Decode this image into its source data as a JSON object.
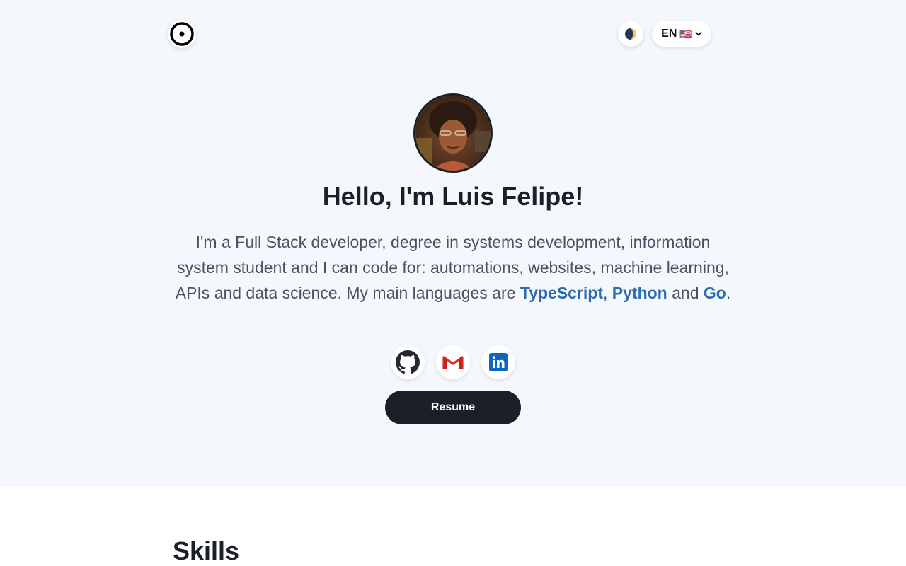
{
  "header": {
    "logo_icon": "circle-dot-icon",
    "theme_icon": "moon-icon",
    "language": {
      "code": "EN",
      "flag": "🇺🇸",
      "chevron_icon": "chevron-down-icon"
    }
  },
  "hero": {
    "avatar_alt": "profile-photo",
    "title": "Hello, I'm Luis Felipe!",
    "intro": {
      "text_before": "I'm a Full Stack developer, degree in systems development, information system student and I can code for: automations, websites, machine learning, APIs and data science. My main languages are ",
      "lang1": "TypeScript",
      "sep1": ", ",
      "lang2": "Python",
      "sep2": " and ",
      "lang3": "Go",
      "text_after": "."
    },
    "socials": [
      {
        "name": "github",
        "icon": "github-icon"
      },
      {
        "name": "gmail",
        "icon": "gmail-icon"
      },
      {
        "name": "linkedin",
        "icon": "linkedin-icon"
      }
    ],
    "resume_label": "Resume"
  },
  "skills": {
    "title": "Skills"
  },
  "colors": {
    "hero_bg": "#f4f8fc",
    "text_dark": "#1b1f27",
    "text_muted": "#4a5262",
    "link": "#2b6cb0",
    "linkedin": "#0a66c2",
    "gmail_red": "#d93025"
  }
}
